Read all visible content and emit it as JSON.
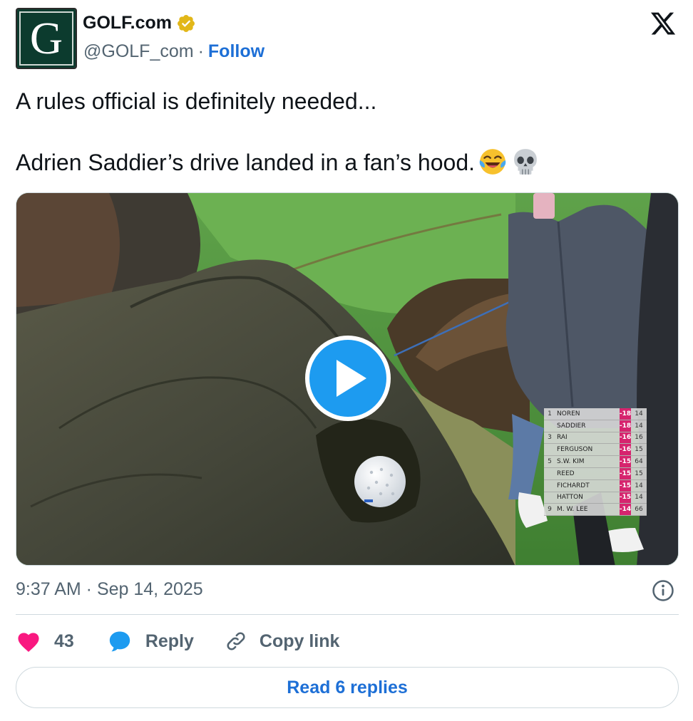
{
  "account": {
    "avatar_letter": "G",
    "display_name": "GOLF.com",
    "handle": "@GOLF_com",
    "separator": "·",
    "follow_label": "Follow"
  },
  "tweet": {
    "line1": "A rules official is definitely needed...",
    "line2": "Adrien Saddier’s drive landed in a fan’s hood.",
    "emojis": [
      "face-with-tears-of-joy-emoji",
      "skull-emoji"
    ]
  },
  "media": {
    "type": "video",
    "leaderboard": [
      {
        "pos": "1",
        "name": "NOREN",
        "score": "-18",
        "thru": "14"
      },
      {
        "pos": "",
        "name": "SADDIER",
        "score": "-18",
        "thru": "14"
      },
      {
        "pos": "3",
        "name": "RAI",
        "score": "-16",
        "thru": "16"
      },
      {
        "pos": "",
        "name": "FERGUSON",
        "score": "-16",
        "thru": "15"
      },
      {
        "pos": "5",
        "name": "S.W. KIM",
        "score": "-15",
        "thru": "64"
      },
      {
        "pos": "",
        "name": "REED",
        "score": "-15",
        "thru": "15"
      },
      {
        "pos": "",
        "name": "FICHARDT",
        "score": "-15",
        "thru": "14"
      },
      {
        "pos": "",
        "name": "HATTON",
        "score": "-15",
        "thru": "14"
      },
      {
        "pos": "9",
        "name": "M. W. LEE",
        "score": "-14",
        "thru": "66"
      }
    ]
  },
  "meta": {
    "timestamp": "9:37 AM · Sep 14, 2025"
  },
  "actions": {
    "like_count": "43",
    "reply_label": "Reply",
    "copy_label": "Copy link"
  },
  "read_replies_label": "Read 6 replies",
  "colors": {
    "like": "#f91880",
    "reply": "#1d9bf0",
    "link": "#1d6fd6",
    "verified": "#e2b719"
  }
}
